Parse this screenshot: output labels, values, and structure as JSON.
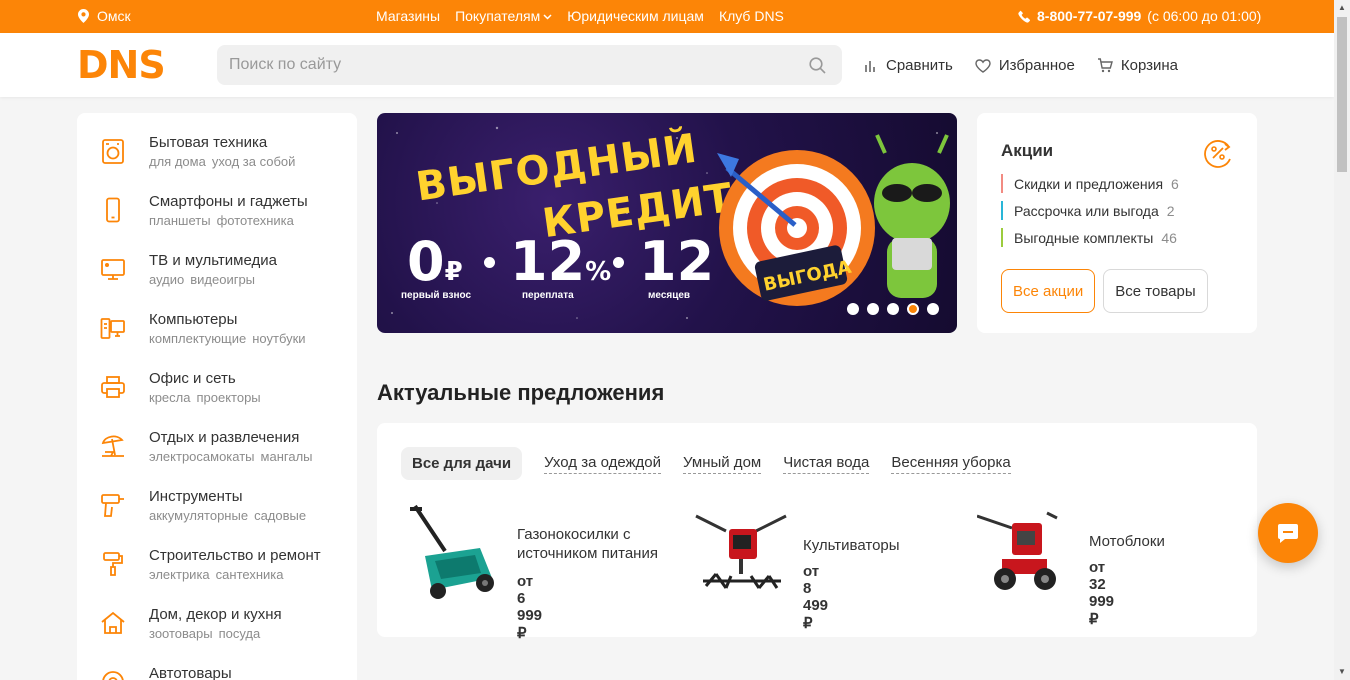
{
  "topbar": {
    "city": "Омск",
    "nav": [
      {
        "label": "Магазины",
        "has_dropdown": false
      },
      {
        "label": "Покупателям",
        "has_dropdown": true
      },
      {
        "label": "Юридическим лицам",
        "has_dropdown": false
      },
      {
        "label": "Клуб DNS",
        "has_dropdown": false
      }
    ],
    "phone": "8-800-77-07-999",
    "hours": "(с 06:00 до 01:00)"
  },
  "header": {
    "logo_text": "DNS",
    "search_placeholder": "Поиск по сайту",
    "links": [
      {
        "label": "Сравнить",
        "icon": "compare-icon"
      },
      {
        "label": "Избранное",
        "icon": "heart-icon"
      },
      {
        "label": "Корзина",
        "icon": "cart-icon"
      }
    ]
  },
  "catalog": {
    "items": [
      {
        "title": "Бытовая техника",
        "subs": [
          "для дома",
          "уход за собой"
        ],
        "icon": "washing-machine-icon"
      },
      {
        "title": "Смартфоны и гаджеты",
        "subs": [
          "планшеты",
          "фототехника"
        ],
        "icon": "smartphone-icon"
      },
      {
        "title": "ТВ и мультимедиа",
        "subs": [
          "аудио",
          "видеоигры"
        ],
        "icon": "tv-icon"
      },
      {
        "title": "Компьютеры",
        "subs": [
          "комплектующие",
          "ноутбуки"
        ],
        "icon": "computer-icon"
      },
      {
        "title": "Офис и сеть",
        "subs": [
          "кресла",
          "проекторы"
        ],
        "icon": "printer-icon"
      },
      {
        "title": "Отдых и развлечения",
        "subs": [
          "электросамокаты",
          "мангалы"
        ],
        "icon": "beach-umbrella-icon"
      },
      {
        "title": "Инструменты",
        "subs": [
          "аккумуляторные",
          "садовые"
        ],
        "icon": "drill-icon"
      },
      {
        "title": "Строительство и ремонт",
        "subs": [
          "электрика",
          "сантехника"
        ],
        "icon": "paint-roller-icon"
      },
      {
        "title": "Дом, декор и кухня",
        "subs": [
          "зоотовары",
          "посуда"
        ],
        "icon": "house-icon"
      },
      {
        "title": "Автотовары",
        "subs": [],
        "icon": "car-wheel-icon"
      }
    ]
  },
  "banner": {
    "title_line1": "ВЫГОДНЫЙ",
    "title_line2": "КРЕДИТ",
    "values": [
      {
        "value": "0",
        "suffix": "₽",
        "caption": "первый взнос"
      },
      {
        "value": "12",
        "suffix": "%",
        "caption": "переплата"
      },
      {
        "value": "12",
        "suffix": "",
        "caption": "месяцев"
      }
    ],
    "sign_text": "ВЫГОДА",
    "slides_count": 5,
    "active_slide": 4
  },
  "promo": {
    "title": "Акции",
    "items": [
      {
        "label": "Скидки и предложения",
        "count": "6",
        "color": "#f28b82"
      },
      {
        "label": "Рассрочка или выгода",
        "count": "2",
        "color": "#29b6d8"
      },
      {
        "label": "Выгодные комплекты",
        "count": "46",
        "color": "#9ccc3d"
      }
    ],
    "button_all_promos": "Все акции",
    "button_all_goods": "Все товары"
  },
  "offers": {
    "title": "Актуальные предложения",
    "tabs": [
      "Все для дачи",
      "Уход за одеждой",
      "Умный дом",
      "Чистая вода",
      "Весенняя уборка"
    ],
    "active_tab": 0,
    "products": [
      {
        "name": "Газонокосилки с источником питания",
        "price": "от 6 999 ₽",
        "icon": "lawn-mower-image"
      },
      {
        "name": "Культиваторы",
        "price": "от 8 499 ₽",
        "icon": "cultivator-image"
      },
      {
        "name": "Мотоблоки",
        "price": "от 32 999 ₽",
        "icon": "motoblock-image"
      }
    ]
  },
  "colors": {
    "brand": "#fc8507",
    "text": "#333333",
    "muted": "#8c8c8c",
    "background": "#f5f5f5"
  }
}
